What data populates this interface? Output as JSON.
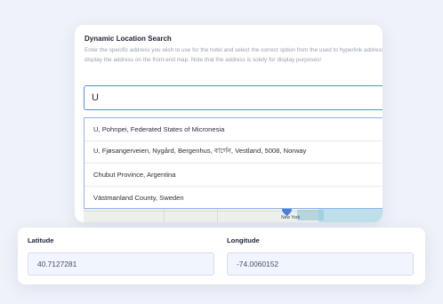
{
  "search": {
    "title": "Dynamic Location Search",
    "description": "Enter the specific address you wish to use for the hotel and select the correct option from the used to hyperlink address and display the address on the front-end map. Note that the address is solely for display purposes!",
    "value": "U"
  },
  "suggestions": [
    "U, Pohnpei, Federated States of Micronesia",
    "U, Fjøsangerveien, Nygård, Bergenhus, বার্গেন, Vestland, 5008, Norway",
    "Chubut Province, Argentina",
    "Västmanland County, Sweden"
  ],
  "map": {
    "city_label": "New York"
  },
  "coordinates": {
    "latitude_label": "Latitude",
    "latitude_value": "40.7127281",
    "longitude_label": "Longitude",
    "longitude_value": "-74.0060152"
  }
}
